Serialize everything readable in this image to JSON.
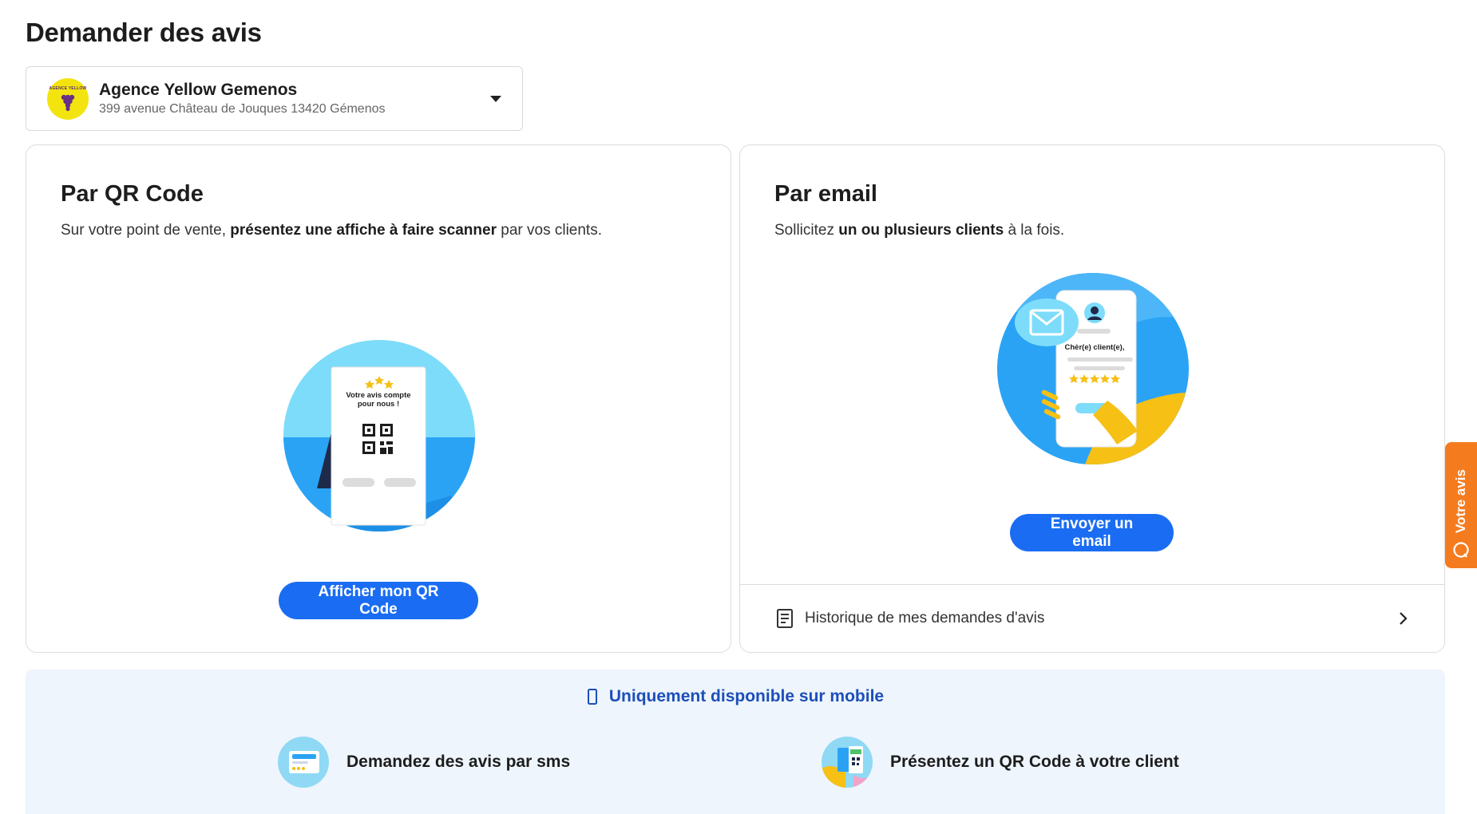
{
  "page": {
    "title": "Demander des avis"
  },
  "location": {
    "name": "Agence Yellow Gemenos",
    "address": "399 avenue Château de Jouques 13420 Gémenos",
    "logo_text": "AGENCE YELLOW"
  },
  "qr_card": {
    "title": "Par QR Code",
    "desc_pre": "Sur votre point de vente, ",
    "desc_bold": "présentez une affiche à faire scanner",
    "desc_post": " par vos clients.",
    "poster_line1": "Votre avis compte",
    "poster_line2": "pour nous !",
    "button_label": "Afficher mon QR Code"
  },
  "email_card": {
    "title": "Par email",
    "desc_pre": "Sollicitez ",
    "desc_bold": "un ou plusieurs clients",
    "desc_post": " à la fois.",
    "phone_text": "Chèr(e) client(e),",
    "button_label": "Envoyer un email",
    "history_label": "Historique de mes demandes d'avis"
  },
  "mobile": {
    "heading": "Uniquement disponible sur mobile",
    "sms_label": "Demandez des avis par sms",
    "qr_label": "Présentez un QR Code à votre client"
  },
  "side_tab": {
    "label": "Votre avis"
  },
  "colors": {
    "primary": "#1a6df2",
    "accent": "#f47c1f",
    "illustration_blue": "#2aa3f5",
    "illustration_light": "#7ddcfa",
    "yellow": "#f6c015"
  }
}
